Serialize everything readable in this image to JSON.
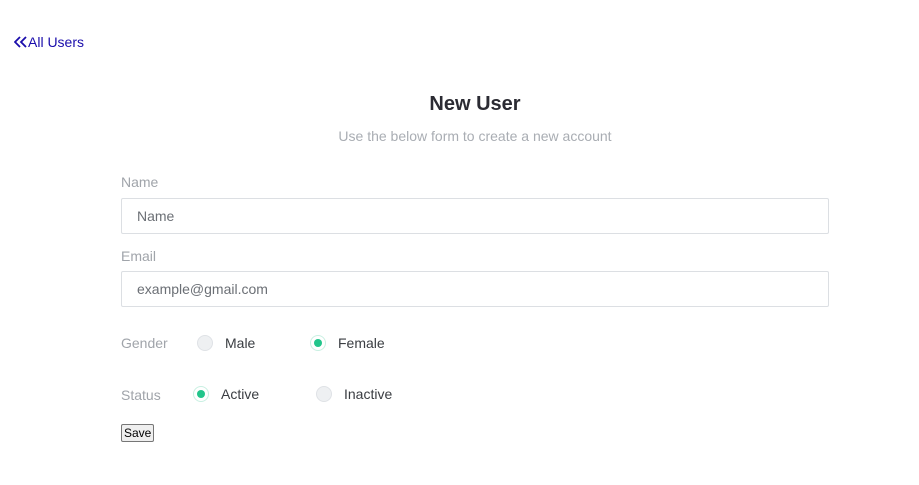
{
  "nav": {
    "back_label": "All Users",
    "back_icon": "double-chevron-left-icon",
    "link_color": "#1a0dab"
  },
  "header": {
    "title": "New User",
    "subtitle": "Use the below form to create a new account"
  },
  "form": {
    "name": {
      "label": "Name",
      "placeholder": "Name",
      "value": ""
    },
    "email": {
      "label": "Email",
      "placeholder": "example@gmail.com",
      "value": ""
    },
    "gender": {
      "label": "Gender",
      "options": [
        {
          "label": "Male",
          "checked": false
        },
        {
          "label": "Female",
          "checked": true
        }
      ]
    },
    "status": {
      "label": "Status",
      "options": [
        {
          "label": "Active",
          "checked": true
        },
        {
          "label": "Inactive",
          "checked": false
        }
      ]
    },
    "save_label": "Save"
  },
  "colors": {
    "accent": "#22c58b"
  }
}
